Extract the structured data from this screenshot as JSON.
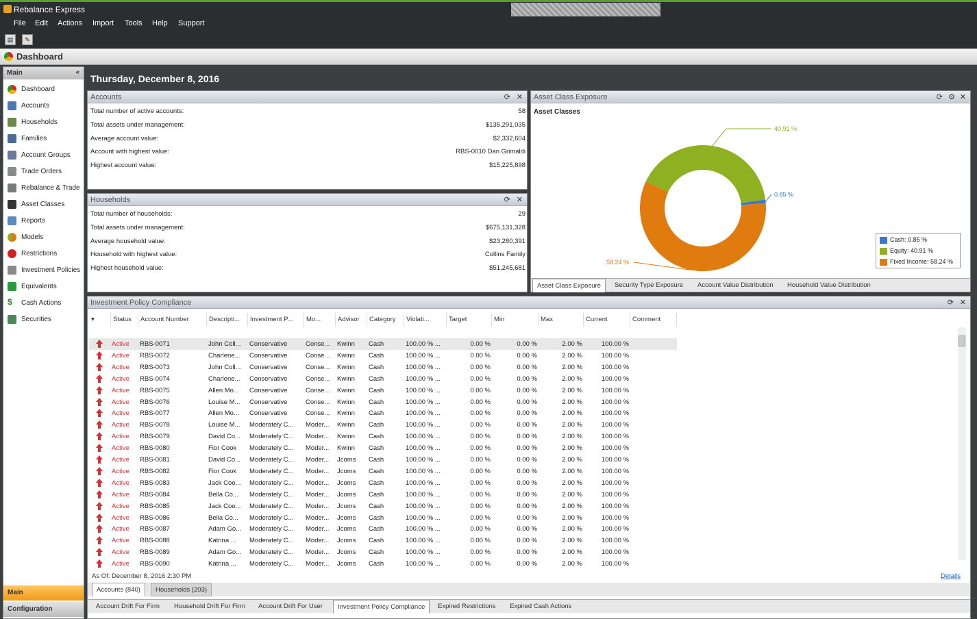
{
  "app": {
    "title": "Rebalance Express"
  },
  "menu": [
    "File",
    "Edit",
    "Actions",
    "Import",
    "Tools",
    "Help",
    "Support"
  ],
  "dashboard": {
    "title": "Dashboard"
  },
  "sidebar": {
    "header": "Main",
    "items": [
      "Dashboard",
      "Accounts",
      "Households",
      "Families",
      "Account Groups",
      "Trade Orders",
      "Rebalance & Trade",
      "Asset Classes",
      "Reports",
      "Models",
      "Restrictions",
      "Investment Policies",
      "Equivalents",
      "Cash Actions",
      "Securities"
    ],
    "bottom_main": "Main",
    "bottom_config": "Configuration"
  },
  "date": "Thursday, December 8, 2016",
  "accounts_panel": {
    "title": "Accounts",
    "rows": [
      {
        "label": "Total number of active accounts:",
        "value": "58"
      },
      {
        "label": "Total assets under management:",
        "value": "$135,291,035"
      },
      {
        "label": "Average account value:",
        "value": "$2,332,604"
      },
      {
        "label": "Account with highest value:",
        "value": "RBS-0010 Dan Grimaldi"
      },
      {
        "label": "Highest account value:",
        "value": "$15,225,898"
      }
    ]
  },
  "households_panel": {
    "title": "Households",
    "rows": [
      {
        "label": "Total number of households:",
        "value": "29"
      },
      {
        "label": "Total assets under management:",
        "value": "$675,131,328"
      },
      {
        "label": "Average household value:",
        "value": "$23,280,391"
      },
      {
        "label": "Household with highest value:",
        "value": "Collins Family"
      },
      {
        "label": "Highest household value:",
        "value": "$51,245,681"
      }
    ]
  },
  "asset_panel": {
    "title": "Asset Class Exposure",
    "subtitle": "Asset Classes",
    "tabs": [
      "Asset Class Exposure",
      "Security Type Exposure",
      "Account Value Distribution",
      "Household Value Distribution"
    ]
  },
  "chart_data": {
    "type": "pie",
    "title": "Asset Classes",
    "categories": [
      "Cash",
      "Equity",
      "Fixed Income"
    ],
    "values": [
      0.85,
      40.91,
      58.24
    ],
    "labels": [
      "0.85 %",
      "40.91 %",
      "58.24 %"
    ],
    "legend": [
      "Cash: 0.85 %",
      "Equity: 40.91 %",
      "Fixed Income: 58.24 %"
    ],
    "colors": [
      "#3a78c8",
      "#8fb020",
      "#e07b10"
    ],
    "legend_position": "bottom-right"
  },
  "compliance": {
    "title": "Investment Policy Compliance",
    "columns": [
      "Status",
      "Account Number",
      "Descripti...",
      "Investment P...",
      "Mo...",
      "Advisor",
      "Category",
      "Violati...",
      "Target",
      "Min",
      "Max",
      "Current",
      "Comment"
    ],
    "rows": [
      [
        "Active",
        "RBS-0071",
        "John Coll...",
        "Conservative",
        "Conse...",
        "Kwinn",
        "Cash",
        "100.00 % ...",
        "0.00 %",
        "0.00 %",
        "2.00 %",
        "100.00 %"
      ],
      [
        "Active",
        "RBS-0072",
        "Charlene...",
        "Conservative",
        "Conse...",
        "Kwinn",
        "Cash",
        "100.00 % ...",
        "0.00 %",
        "0.00 %",
        "2.00 %",
        "100.00 %"
      ],
      [
        "Active",
        "RBS-0073",
        "John Coll...",
        "Conservative",
        "Conse...",
        "Kwinn",
        "Cash",
        "100.00 % ...",
        "0.00 %",
        "0.00 %",
        "2.00 %",
        "100.00 %"
      ],
      [
        "Active",
        "RBS-0074",
        "Charlene...",
        "Conservative",
        "Conse...",
        "Kwinn",
        "Cash",
        "100.00 % ...",
        "0.00 %",
        "0.00 %",
        "2.00 %",
        "100.00 %"
      ],
      [
        "Active",
        "RBS-0075",
        "Allen Mo...",
        "Conservative",
        "Conse...",
        "Kwinn",
        "Cash",
        "100.00 % ...",
        "0.00 %",
        "0.00 %",
        "2.00 %",
        "100.00 %"
      ],
      [
        "Active",
        "RBS-0076",
        "Louise M...",
        "Conservative",
        "Conse...",
        "Kwinn",
        "Cash",
        "100.00 % ...",
        "0.00 %",
        "0.00 %",
        "2.00 %",
        "100.00 %"
      ],
      [
        "Active",
        "RBS-0077",
        "Allen Mo...",
        "Conservative",
        "Conse...",
        "Kwinn",
        "Cash",
        "100.00 % ...",
        "0.00 %",
        "0.00 %",
        "2.00 %",
        "100.00 %"
      ],
      [
        "Active",
        "RBS-0078",
        "Louise M...",
        "Moderately C...",
        "Moder...",
        "Kwinn",
        "Cash",
        "100.00 % ...",
        "0.00 %",
        "0.00 %",
        "2.00 %",
        "100.00 %"
      ],
      [
        "Active",
        "RBS-0079",
        "David Co...",
        "Moderately C...",
        "Moder...",
        "Kwinn",
        "Cash",
        "100.00 % ...",
        "0.00 %",
        "0.00 %",
        "2.00 %",
        "100.00 %"
      ],
      [
        "Active",
        "RBS-0080",
        "Fior Cook",
        "Moderately C...",
        "Moder...",
        "Kwinn",
        "Cash",
        "100.00 % ...",
        "0.00 %",
        "0.00 %",
        "2.00 %",
        "100.00 %"
      ],
      [
        "Active",
        "RBS-0081",
        "David Co...",
        "Moderately C...",
        "Moder...",
        "Jcoms",
        "Cash",
        "100.00 % ...",
        "0.00 %",
        "0.00 %",
        "2.00 %",
        "100.00 %"
      ],
      [
        "Active",
        "RBS-0082",
        "Fior Cook",
        "Moderately C...",
        "Moder...",
        "Jcoms",
        "Cash",
        "100.00 % ...",
        "0.00 %",
        "0.00 %",
        "2.00 %",
        "100.00 %"
      ],
      [
        "Active",
        "RBS-0083",
        "Jack Coo...",
        "Moderately C...",
        "Moder...",
        "Jcoms",
        "Cash",
        "100.00 % ...",
        "0.00 %",
        "0.00 %",
        "2.00 %",
        "100.00 %"
      ],
      [
        "Active",
        "RBS-0084",
        "Bella Co...",
        "Moderately C...",
        "Moder...",
        "Jcoms",
        "Cash",
        "100.00 % ...",
        "0.00 %",
        "0.00 %",
        "2.00 %",
        "100.00 %"
      ],
      [
        "Active",
        "RBS-0085",
        "Jack Coo...",
        "Moderately C...",
        "Moder...",
        "Jcoms",
        "Cash",
        "100.00 % ...",
        "0.00 %",
        "0.00 %",
        "2.00 %",
        "100.00 %"
      ],
      [
        "Active",
        "RBS-0086",
        "Bella Co...",
        "Moderately C...",
        "Moder...",
        "Jcoms",
        "Cash",
        "100.00 % ...",
        "0.00 %",
        "0.00 %",
        "2.00 %",
        "100.00 %"
      ],
      [
        "Active",
        "RBS-0087",
        "Adam Go...",
        "Moderately C...",
        "Moder...",
        "Jcoms",
        "Cash",
        "100.00 % ...",
        "0.00 %",
        "0.00 %",
        "2.00 %",
        "100.00 %"
      ],
      [
        "Active",
        "RBS-0088",
        "Katrina ...",
        "Moderately C...",
        "Moder...",
        "Jcoms",
        "Cash",
        "100.00 % ...",
        "0.00 %",
        "0.00 %",
        "2.00 %",
        "100.00 %"
      ],
      [
        "Active",
        "RBS-0089",
        "Adam Go...",
        "Moderately C...",
        "Moder...",
        "Jcoms",
        "Cash",
        "100.00 % ...",
        "0.00 %",
        "0.00 %",
        "2.00 %",
        "100.00 %"
      ],
      [
        "Active",
        "RBS-0090",
        "Katrina ...",
        "Moderately C...",
        "Moder...",
        "Jcoms",
        "Cash",
        "100.00 % ...",
        "0.00 %",
        "0.00 %",
        "2.00 %",
        "100.00 %"
      ]
    ],
    "asof": "As Of: December 8, 2016 2:30 PM",
    "details": "Details",
    "subtabs": [
      "Accounts (840)",
      "Households (203)"
    ],
    "bottomtabs": [
      "Account Drift For Firm",
      "Household Drift For Firm",
      "Account Drift For User",
      "Investment Policy Compliance",
      "Expired Restrictions",
      "Expired Cash Actions"
    ]
  },
  "colors": {
    "active_status": "#d83030",
    "accent_bar": "#f6a623"
  }
}
